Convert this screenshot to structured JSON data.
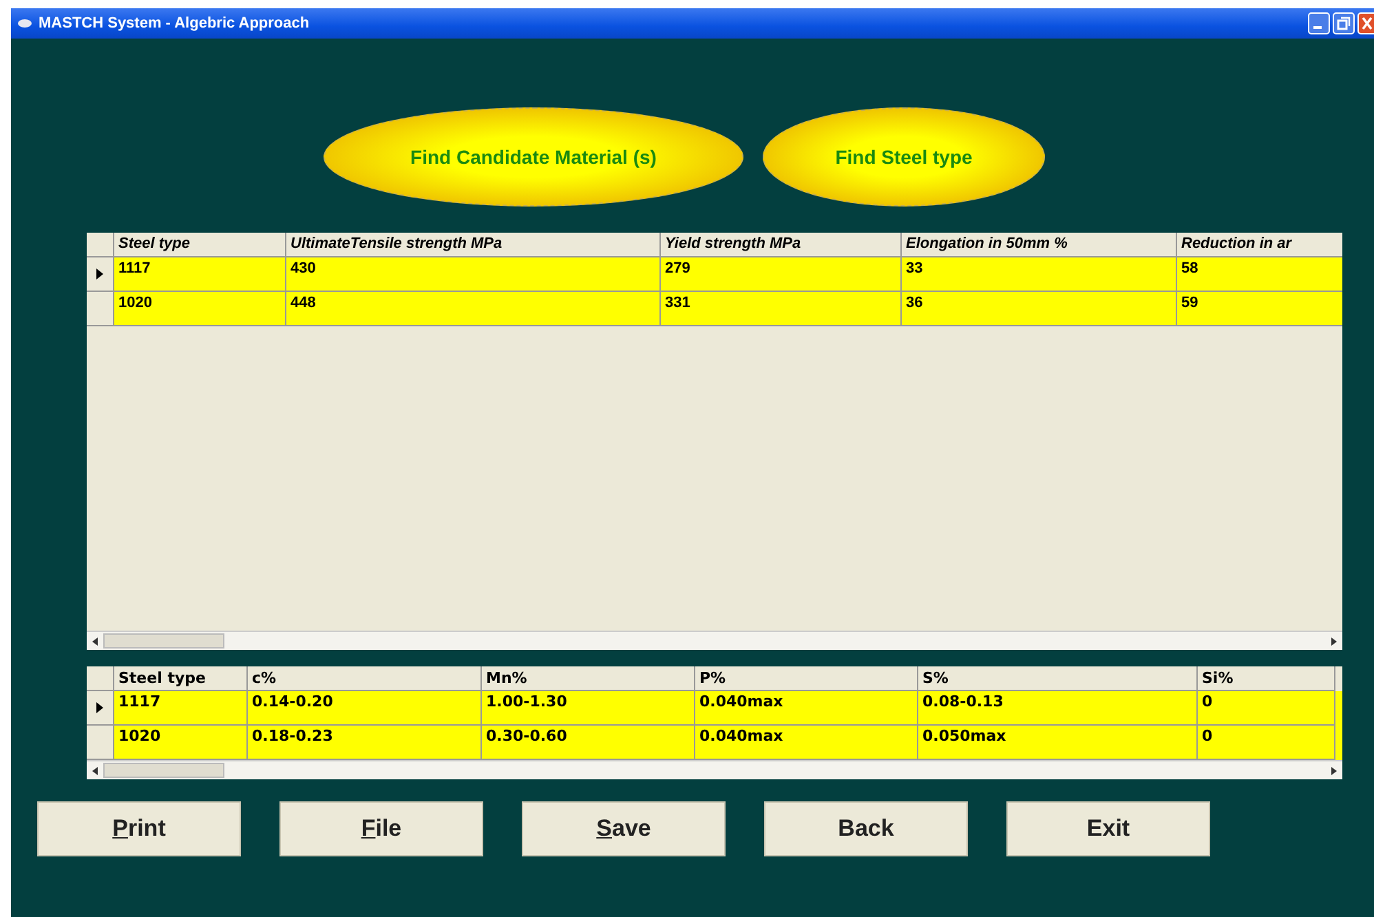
{
  "window": {
    "title": "MASTCH System - Algebric Approach"
  },
  "action_buttons": [
    {
      "label": "Find Candidate Material (s)"
    },
    {
      "label": "Find Steel type"
    }
  ],
  "properties_table": {
    "columns": [
      "Steel type",
      "UltimateTensile strength MPa",
      "Yield strength MPa",
      "Elongation in 50mm %",
      "Reduction in ar"
    ],
    "rows": [
      {
        "current": true,
        "cells": [
          "1117",
          "430",
          "279",
          "33",
          "58"
        ]
      },
      {
        "current": false,
        "cells": [
          "1020",
          "448",
          "331",
          "36",
          "59"
        ]
      }
    ]
  },
  "composition_table": {
    "columns": [
      "Steel type",
      "c%",
      "Mn%",
      "P%",
      "S%",
      "Si%"
    ],
    "rows": [
      {
        "current": true,
        "cells": [
          "1117",
          "0.14-0.20",
          "1.00-1.30",
          "0.040max",
          "0.08-0.13",
          "0"
        ]
      },
      {
        "current": false,
        "cells": [
          "1020",
          "0.18-0.23",
          "0.30-0.60",
          "0.040max",
          "0.050max",
          "0"
        ]
      }
    ]
  },
  "buttons": [
    {
      "label": "Print",
      "underlined": true
    },
    {
      "label": "File",
      "underlined": true
    },
    {
      "label": "Save",
      "underlined": true
    },
    {
      "label": "Back",
      "underlined": false
    },
    {
      "label": "Exit",
      "underlined": false
    }
  ]
}
